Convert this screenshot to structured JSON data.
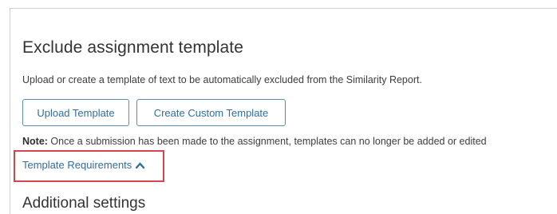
{
  "section": {
    "title": "Exclude assignment template",
    "description": "Upload or create a template of text to be automatically excluded from the Similarity Report."
  },
  "buttons": {
    "upload_label": "Upload Template",
    "custom_label": "Create Custom Template"
  },
  "note": {
    "prefix": "Note:",
    "text": " Once a submission has been made to the assignment, templates can no longer be added or edited"
  },
  "requirements": {
    "link_label": "Template Requirements",
    "icon": "chevron-up-icon",
    "highlight_color": "#d6454a"
  },
  "additional": {
    "title": "Additional settings"
  },
  "colors": {
    "link": "#2f6e9e",
    "button_border": "#5b8cb4",
    "text": "#333333"
  }
}
